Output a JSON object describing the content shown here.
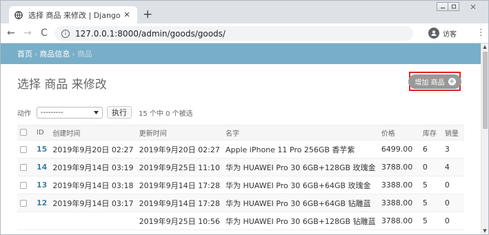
{
  "browser": {
    "tab_title": "选择 商品 来修改 | Django 站点",
    "tab_close": "✕",
    "new_tab": "+",
    "url": "127.0.0.1:8000/admin/goods/goods/",
    "profile_name": "访客",
    "nav": {
      "back": "←",
      "forward": "→",
      "reload": "C"
    },
    "menu": "⋮"
  },
  "breadcrumbs": {
    "home": "首页",
    "section": "商品信息",
    "current": "商品",
    "sep": "›"
  },
  "header": {
    "title": "选择 商品 来修改",
    "add_button": "增加 商品",
    "add_plus": "+"
  },
  "actions": {
    "label": "动作",
    "select_value": "---------",
    "go_button": "执行",
    "counter": "15 个中 0 个被选"
  },
  "table": {
    "columns": {
      "id": "ID",
      "created": "创建时间",
      "updated": "更新时间",
      "name": "名字",
      "price": "价格",
      "stock": "库存",
      "sales": "销量"
    },
    "rows": [
      {
        "id": "15",
        "created": "2019年9月20日 02:27",
        "updated": "2019年9月20日 02:27",
        "name": "Apple iPhone 11 Pro 256GB 香芋紫",
        "price": "6499.00",
        "stock": "6",
        "sales": "3"
      },
      {
        "id": "14",
        "created": "2019年9月14日 03:19",
        "updated": "2019年9月25日 11:10",
        "name": "华为 HUAWEI Pro 30 6GB+128GB 玫瑰金",
        "price": "3788.00",
        "stock": "0",
        "sales": "4"
      },
      {
        "id": "13",
        "created": "2019年9月14日 03:18",
        "updated": "2019年9月14日 17:28",
        "name": "华为 HUAWEI Pro 30 6GB+64GB 玫瑰金",
        "price": "3388.00",
        "stock": "5",
        "sales": "0"
      },
      {
        "id": "12",
        "created": "2019年9月14日 03:17",
        "updated": "2019年9月14日 17:28",
        "name": "华为 HUAWEI Pro 30 6GB+64GB 钻雕蓝",
        "price": "3388.00",
        "stock": "5",
        "sales": "0"
      },
      {
        "id": "",
        "created": "",
        "updated": "2019年9月25日 10:56",
        "name": "华为 HUAWEI Pro 30 6GB+128GB 钻雕蓝",
        "price": "3788.00",
        "stock": "5",
        "sales": "0"
      }
    ]
  },
  "colors": {
    "breadcrumb_bg": "#79aec8",
    "link": "#447e9b",
    "highlight_box": "#e12222",
    "addlink_bg": "#999999"
  },
  "icons": {
    "favicon": "globe-icon",
    "info": "info-icon",
    "profile": "user-avatar-icon",
    "select_arrow": "caret-down-icon"
  }
}
